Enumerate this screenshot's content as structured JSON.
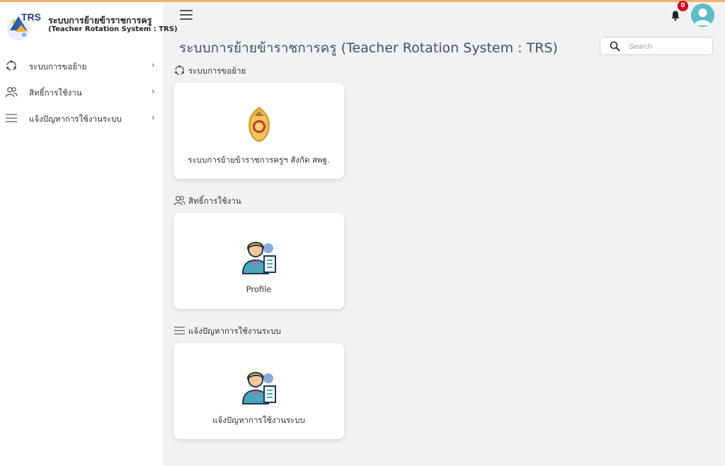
{
  "brand": {
    "logo_text": "TRS",
    "title": "ระบบการย้ายข้าราชการครู",
    "subtitle": "(Teacher Rotation System : TRS)"
  },
  "sidebar": {
    "items": [
      {
        "label": "ระบบการขอย้าย",
        "icon": "refresh-cycle-icon"
      },
      {
        "label": "สิทธิ์การใช้งาน",
        "icon": "users-icon"
      },
      {
        "label": "แจ้งปัญหาการใช้งานระบบ",
        "icon": "list-lines-icon"
      }
    ]
  },
  "header": {
    "notification_count": "0",
    "page_title": "ระบบการย้ายข้าราชการครู (Teacher Rotation System : TRS)",
    "search_placeholder": "Search"
  },
  "sections": [
    {
      "title": "ระบบการขอย้าย",
      "card_label": "ระบบการย้ายข้าราชการครูฯ สังกัด สพฐ."
    },
    {
      "title": "สิทธิ์การใช้งาน",
      "card_label": "Profile"
    },
    {
      "title": "แจ้งปัญหาการใช้งานระบบ",
      "card_label": "แจ้งปัญหาการใช้งานระบบ"
    }
  ],
  "colors": {
    "accent_topline": "#f6b26b",
    "title": "#3b5470",
    "avatar": "#5bbcc4",
    "badge": "#d0021b"
  }
}
